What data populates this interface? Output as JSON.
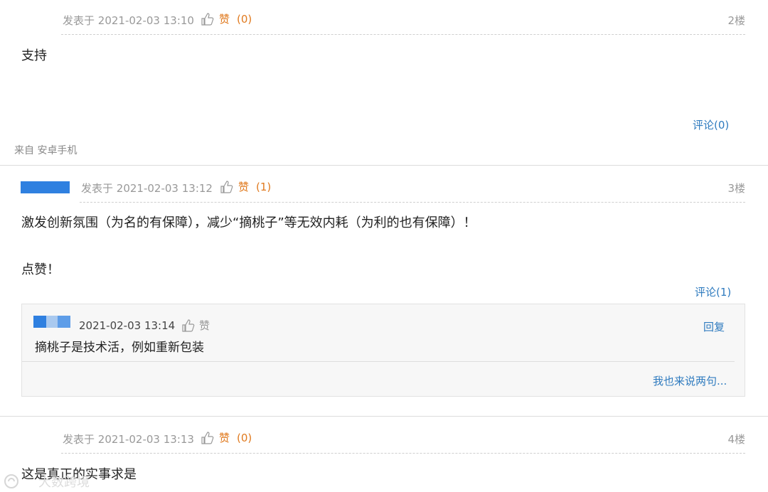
{
  "post2": {
    "posted_label": "发表于",
    "time": "2021-02-03 13:10",
    "like_label": "赞",
    "like_count": "(0)",
    "floor": "2楼",
    "content": "支持",
    "comment_link": "评论(0)",
    "from_label": "来自 安卓手机"
  },
  "post3": {
    "posted_label": "发表于",
    "time": "2021-02-03 13:12",
    "like_label": "赞",
    "like_count": "(1)",
    "floor": "3楼",
    "content_line1": "激发创新氛围（为名的有保障），减少“摘桃子”等无效内耗（为利的也有保障）！",
    "content_line2": "点赞！",
    "comment_link": "评论(1)",
    "reply": {
      "time": "2021-02-03 13:14",
      "like_label": "赞",
      "reply_link": "回复",
      "content": "摘桃子是技术活，例如重新包装",
      "add_comment_link": "我也来说两句..."
    }
  },
  "post4": {
    "posted_label": "发表于",
    "time": "2021-02-03 13:13",
    "like_label": "赞",
    "like_count": "(0)",
    "floor": "4楼",
    "content": "这是真正的实事求是"
  },
  "watermark": {
    "text": "大数跨境"
  },
  "colors": {
    "accent_link": "#2f7bbf",
    "like": "#e07a1f",
    "masked_avatar": "#2f80e0"
  }
}
